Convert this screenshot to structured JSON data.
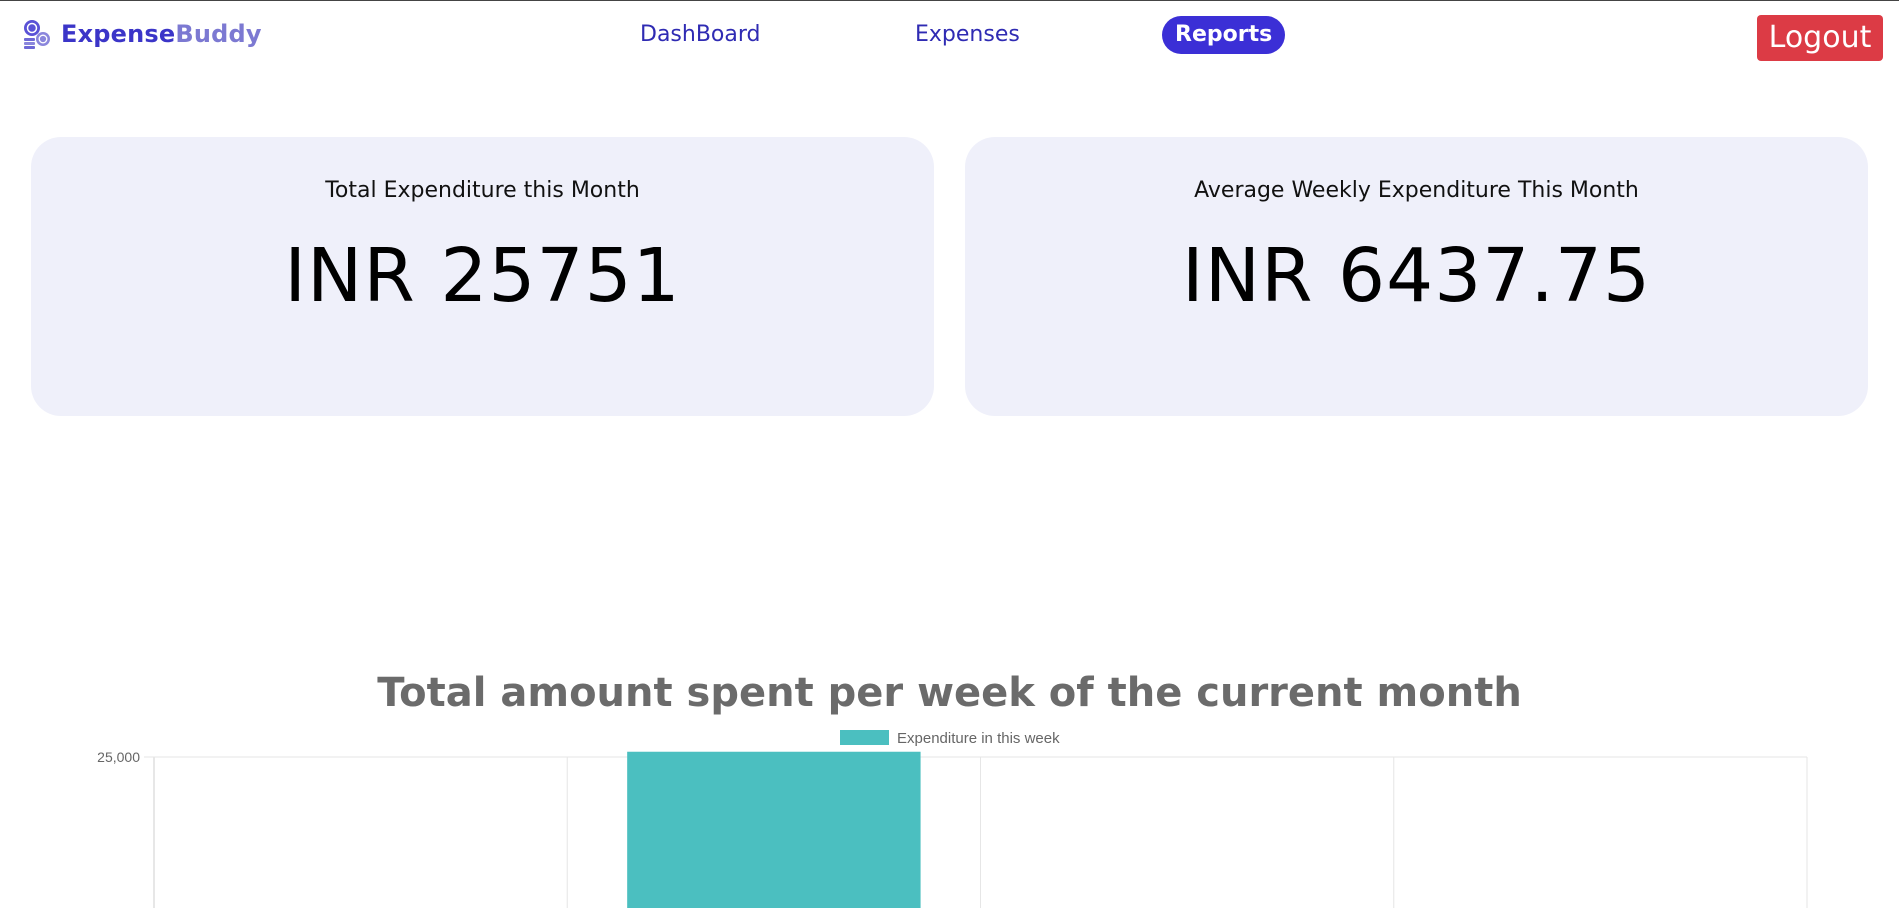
{
  "navbar": {
    "brand_part1": "Expense",
    "brand_part2": "Buddy",
    "links": [
      {
        "label": "DashBoard",
        "active": false
      },
      {
        "label": "Expenses",
        "active": false
      },
      {
        "label": "Reports",
        "active": true
      }
    ],
    "logout_label": "Logout"
  },
  "stats": {
    "total": {
      "title": "Total Expenditure this Month",
      "value": "INR 25751"
    },
    "average": {
      "title": "Average Weekly Expenditure This Month",
      "value": "INR 6437.75"
    }
  },
  "colors": {
    "accent": "#3b2fd6",
    "logout": "#dc3b45",
    "card_bg": "#eff0fa",
    "bar": "#4bbfc0"
  },
  "chart_data": {
    "type": "bar",
    "title": "Total amount spent per week of the current month",
    "legend": {
      "label": "Expenditure in this week",
      "placement": "top-center"
    },
    "categories": [
      "",
      "",
      "",
      ""
    ],
    "series": [
      {
        "name": "Expenditure in this week",
        "values": [
          0,
          25751,
          0,
          0
        ]
      }
    ],
    "y_tick_labels": [
      {
        "value": 25000,
        "label": "25,000"
      }
    ],
    "ylim": [
      0,
      30000
    ],
    "grid": true
  }
}
